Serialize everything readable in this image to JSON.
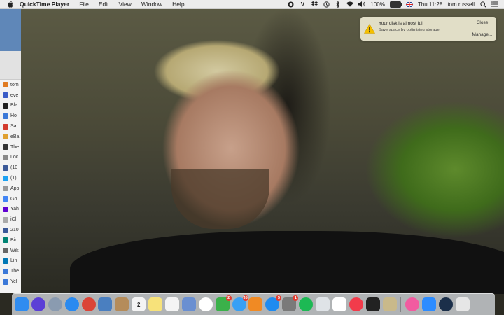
{
  "menubar": {
    "app_name": "QuickTime Player",
    "menus": [
      "File",
      "Edit",
      "View",
      "Window",
      "Help"
    ],
    "status": {
      "battery_percent": "100%",
      "time": "Thu 11:28",
      "user": "tom russell"
    }
  },
  "background_window": {
    "bookmarks": [
      {
        "label": "tom",
        "color": "#e07b22"
      },
      {
        "label": "eve",
        "color": "#3a5cc7"
      },
      {
        "label": "Bla",
        "color": "#222222"
      },
      {
        "label": "Ho",
        "color": "#3b78d8"
      },
      {
        "label": "Sa",
        "color": "#d33a2c"
      },
      {
        "label": "eBa",
        "color": "#e0a030"
      },
      {
        "label": "The",
        "color": "#333333"
      },
      {
        "label": "Loc",
        "color": "#888888"
      },
      {
        "label": "(10",
        "color": "#3b5998"
      },
      {
        "label": "(1)",
        "color": "#1da1f2"
      },
      {
        "label": "App",
        "color": "#999999"
      },
      {
        "label": "Go",
        "color": "#4285f4"
      },
      {
        "label": "Yah",
        "color": "#6001d2"
      },
      {
        "label": "iCl",
        "color": "#aaaaaa"
      },
      {
        "label": "210",
        "color": "#3b5998"
      },
      {
        "label": "Bin",
        "color": "#008373"
      },
      {
        "label": "Wik",
        "color": "#666666"
      },
      {
        "label": "Lin",
        "color": "#0077b5"
      },
      {
        "label": "The",
        "color": "#3b78d8"
      },
      {
        "label": "Yel",
        "color": "#3b78d8"
      }
    ]
  },
  "notification": {
    "title": "Your disk is almost full",
    "message": "Save space by optimising storage.",
    "close_label": "Close",
    "manage_label": "Manage..."
  },
  "dock": {
    "apps": [
      {
        "name": "finder-icon",
        "color": "#2f8cf0",
        "badge": ""
      },
      {
        "name": "siri-icon",
        "color": "#5b3fd6",
        "badge": "",
        "round": true
      },
      {
        "name": "launchpad-icon",
        "color": "#8a9bb0",
        "badge": "",
        "round": true
      },
      {
        "name": "safari-icon",
        "color": "#2a8af0",
        "badge": "",
        "round": true
      },
      {
        "name": "chrome-icon",
        "color": "#db4437",
        "badge": "",
        "round": true
      },
      {
        "name": "preview-icon",
        "color": "#4a7fc0",
        "badge": ""
      },
      {
        "name": "contacts-icon",
        "color": "#b58c5a",
        "badge": ""
      },
      {
        "name": "calendar-icon",
        "color": "#f4f4f4",
        "badge": "",
        "text": "2"
      },
      {
        "name": "notes-icon",
        "color": "#f7e27a",
        "badge": ""
      },
      {
        "name": "reminders-icon",
        "color": "#f4f4f4",
        "badge": ""
      },
      {
        "name": "photo-booth-icon",
        "color": "#6a8fd1",
        "badge": ""
      },
      {
        "name": "photos-icon",
        "color": "#ffffff",
        "badge": "",
        "round": true
      },
      {
        "name": "facetime-icon",
        "color": "#3bb14a",
        "badge": "2"
      },
      {
        "name": "messages-icon",
        "color": "#38a0f5",
        "badge": "35",
        "round": true
      },
      {
        "name": "books-icon",
        "color": "#f08a24",
        "badge": ""
      },
      {
        "name": "app-store-icon",
        "color": "#1f8bf0",
        "badge": "5",
        "round": true
      },
      {
        "name": "system-preferences-icon",
        "color": "#7a7a7a",
        "badge": "1"
      },
      {
        "name": "spotify-icon",
        "color": "#1db954",
        "badge": "",
        "round": true
      },
      {
        "name": "help-icon",
        "color": "#dfe3e7",
        "badge": ""
      },
      {
        "name": "document-icon",
        "color": "#ffffff",
        "badge": ""
      },
      {
        "name": "news-icon",
        "color": "#f23b4b",
        "badge": "",
        "round": true
      },
      {
        "name": "terminal-icon",
        "color": "#222222",
        "badge": ""
      },
      {
        "name": "archive-utility-icon",
        "color": "#c9b98a",
        "badge": ""
      }
    ],
    "apps_right": [
      {
        "name": "itunes-icon",
        "color": "#f25ba0",
        "badge": "",
        "round": true
      },
      {
        "name": "zoom-icon",
        "color": "#2d8cff",
        "badge": ""
      },
      {
        "name": "quicktime-icon",
        "color": "#1b2f4a",
        "badge": "",
        "round": true
      }
    ],
    "trash": {
      "name": "trash-icon",
      "color": "#e6e6e6",
      "badge": ""
    }
  }
}
